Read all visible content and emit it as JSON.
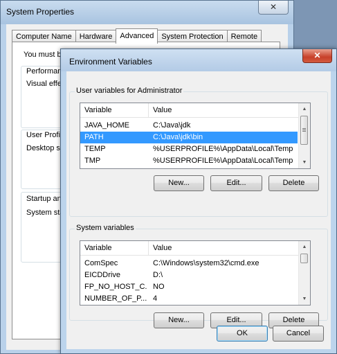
{
  "system_properties": {
    "title": "System Properties",
    "close_glyph": "✕",
    "tabs": [
      {
        "label": "Computer Name",
        "active": false
      },
      {
        "label": "Hardware",
        "active": false
      },
      {
        "label": "Advanced",
        "active": true
      },
      {
        "label": "System Protection",
        "active": false
      },
      {
        "label": "Remote",
        "active": false
      }
    ],
    "visible_text": {
      "line1": "You must be",
      "performance": "Performance",
      "performance_desc": "Visual effec",
      "user_profiles": "User Profile",
      "user_profiles_desc": "Desktop se",
      "startup": "Startup and",
      "startup_desc": "System star"
    }
  },
  "environment_variables": {
    "title": "Environment Variables",
    "close_glyph": "✕",
    "user_group": {
      "title": "User variables for Administrator",
      "columns": [
        "Variable",
        "Value"
      ],
      "rows": [
        {
          "variable": "JAVA_HOME",
          "value": "C:\\Java\\jdk",
          "selected": false
        },
        {
          "variable": "PATH",
          "value": "C:\\Java\\jdk\\bin",
          "selected": true
        },
        {
          "variable": "TEMP",
          "value": "%USERPROFILE%\\AppData\\Local\\Temp",
          "selected": false
        },
        {
          "variable": "TMP",
          "value": "%USERPROFILE%\\AppData\\Local\\Temp",
          "selected": false
        }
      ],
      "buttons": {
        "new": "New...",
        "edit": "Edit...",
        "delete": "Delete"
      }
    },
    "system_group": {
      "title": "System variables",
      "columns": [
        "Variable",
        "Value"
      ],
      "rows": [
        {
          "variable": "ComSpec",
          "value": "C:\\Windows\\system32\\cmd.exe",
          "selected": false
        },
        {
          "variable": "EICDDrive",
          "value": "D:\\",
          "selected": false
        },
        {
          "variable": "FP_NO_HOST_C...",
          "value": "NO",
          "selected": false
        },
        {
          "variable": "NUMBER_OF_P...",
          "value": "4",
          "selected": false
        }
      ],
      "buttons": {
        "new": "New...",
        "edit": "Edit...",
        "delete": "Delete"
      }
    },
    "footer_buttons": {
      "ok": "OK",
      "cancel": "Cancel"
    }
  },
  "colors": {
    "selection": "#3399ff",
    "desktop": "#7d96b4",
    "close_button": "#c7402a"
  }
}
